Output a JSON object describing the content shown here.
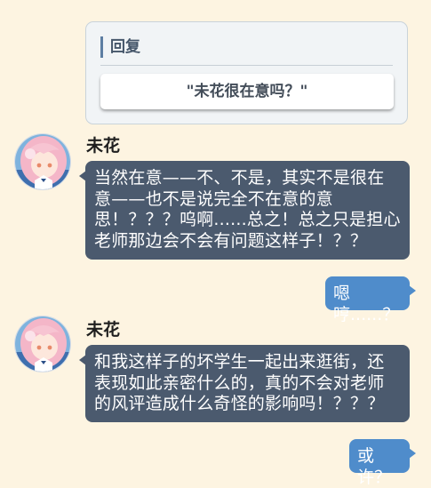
{
  "reply": {
    "header": "回复",
    "option": "\"未花很在意吗？\""
  },
  "messages": [
    {
      "speaker": "未花",
      "text": "当然在意——不、不是，其实不是很在意——也不是说完全不在意的意思！？？？呜啊......总之！总之只是担心老师那边会不会有问题这样子！？？"
    },
    {
      "self": "嗯哼......？"
    },
    {
      "speaker": "未花",
      "text": "和我这样子的坏学生一起出来逛街，还表现如此亲密什么的，真的不会对老师的风评造成什么奇怪的影响吗！？？？"
    },
    {
      "self": "或许？"
    }
  ],
  "colors": {
    "background": "#fdf4e1",
    "student_bubble": "#4b5a6e",
    "sensei_bubble": "#4f8ccb",
    "reply_accent": "#5d7ea2"
  },
  "icons": {
    "avatar": "mika-avatar-portrait"
  }
}
